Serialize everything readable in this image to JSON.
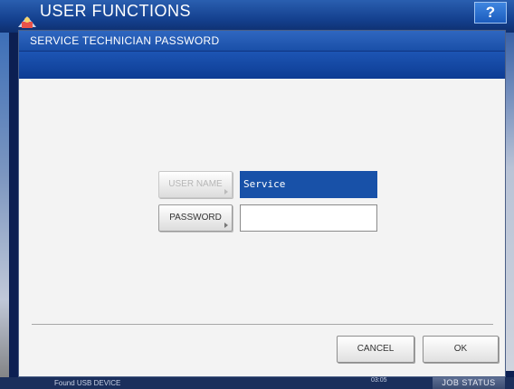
{
  "app": {
    "title": "USER FUNCTIONS",
    "help_label": "?"
  },
  "dialog": {
    "title": "SERVICE TECHNICIAN PASSWORD",
    "username_button": "USER NAME",
    "username_value": "Service",
    "password_button": "PASSWORD",
    "password_value": "",
    "cancel_label": "CANCEL",
    "ok_label": "OK"
  },
  "status": {
    "message": "Found USB DEVICE",
    "clock": "03:05",
    "job_status_label": "JOB STATUS"
  },
  "colors": {
    "title_bar": "#1a4fa8",
    "selected_field": "#1851a8",
    "dialog_background": "#f3f3f3"
  },
  "icons": {
    "app": "user-functions-icon",
    "help": "help-icon"
  }
}
